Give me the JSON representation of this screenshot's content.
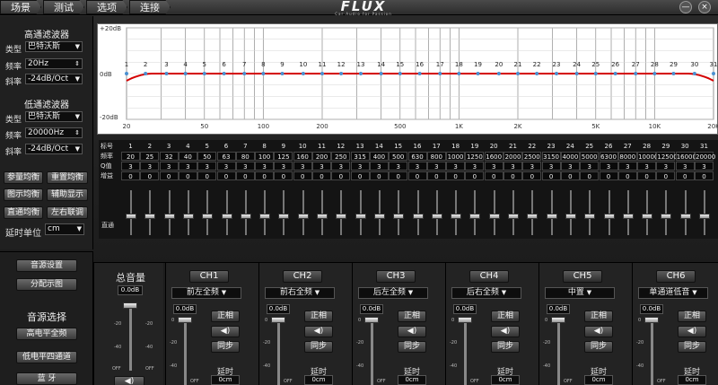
{
  "tabs": [
    "场景",
    "测试",
    "选项",
    "连接"
  ],
  "logo": {
    "brand": "FLUX",
    "tagline": "Car Audio for Passion"
  },
  "window_buttons": [
    "—",
    "×"
  ],
  "highpass": {
    "title": "高通滤波器",
    "type_label": "类型",
    "type_value": "巴特沃斯",
    "freq_label": "频率",
    "freq_value": "20Hz",
    "slope_label": "斜率",
    "slope_value": "-24dB/Oct"
  },
  "lowpass": {
    "title": "低通滤波器",
    "type_label": "类型",
    "type_value": "巴特沃斯",
    "freq_label": "频率",
    "freq_value": "20000Hz",
    "slope_label": "斜率",
    "slope_value": "-24dB/Oct"
  },
  "eq_buttons": [
    "参量均衡",
    "重置均衡",
    "图示均衡",
    "辅助显示",
    "直通均衡",
    "左右联调"
  ],
  "delay_unit": {
    "label": "延时单位",
    "value": "cm"
  },
  "settings_buttons": [
    "音源设置",
    "分配示图"
  ],
  "source": {
    "title": "音源选择",
    "buttons": [
      "高电平全频",
      "低电平四通道",
      "蓝 牙"
    ]
  },
  "graph": {
    "ymax": "+20dB",
    "ymid": "0dB",
    "ymin": "-20dB",
    "xticks": [
      "20",
      "50",
      "100",
      "200",
      "500",
      "1K",
      "2K",
      "5K",
      "10K",
      "20K"
    ]
  },
  "band_table": {
    "row_labels": [
      "标号",
      "频率",
      "Q值",
      "增益"
    ],
    "numbers": [
      "1",
      "2",
      "3",
      "4",
      "5",
      "6",
      "7",
      "8",
      "9",
      "10",
      "11",
      "12",
      "13",
      "14",
      "15",
      "16",
      "17",
      "18",
      "19",
      "20",
      "21",
      "22",
      "23",
      "24",
      "25",
      "26",
      "27",
      "28",
      "29",
      "30",
      "31"
    ],
    "freqs": [
      "20",
      "25",
      "32",
      "40",
      "50",
      "63",
      "80",
      "100",
      "125",
      "160",
      "200",
      "250",
      "315",
      "400",
      "500",
      "630",
      "800",
      "1000",
      "1250",
      "1600",
      "2000",
      "2500",
      "3150",
      "4000",
      "5000",
      "6300",
      "8000",
      "10000",
      "12500",
      "16000",
      "20000"
    ],
    "q": "3",
    "gain": "0",
    "direct_label": "直通"
  },
  "master": {
    "title": "总音量",
    "db": "0.0dB"
  },
  "channels": [
    {
      "name": "CH1",
      "assign": "前左全频",
      "db": "0.0dB",
      "phase": "正相",
      "mute": "◀)",
      "sync": "同步",
      "delay_label": "延时",
      "delay": "0cm"
    },
    {
      "name": "CH2",
      "assign": "前右全频",
      "db": "0.0dB",
      "phase": "正相",
      "mute": "◀)",
      "sync": "同步",
      "delay_label": "延时",
      "delay": "0cm"
    },
    {
      "name": "CH3",
      "assign": "后左全频",
      "db": "0.0dB",
      "phase": "正相",
      "mute": "◀)",
      "sync": "同步",
      "delay_label": "延时",
      "delay": "0cm"
    },
    {
      "name": "CH4",
      "assign": "后右全频",
      "db": "0.0dB",
      "phase": "正相",
      "mute": "◀)",
      "sync": "同步",
      "delay_label": "延时",
      "delay": "0cm"
    },
    {
      "name": "CH5",
      "assign": "中置",
      "db": "0.0dB",
      "phase": "正相",
      "mute": "◀)",
      "sync": "同步",
      "delay_label": "延时",
      "delay": "0cm"
    },
    {
      "name": "CH6",
      "assign": "单通道低音",
      "db": "0.0dB",
      "phase": "正相",
      "mute": "◀)",
      "sync": "同步",
      "delay_label": "延时",
      "delay": "0cm"
    }
  ],
  "slider_ticks": [
    "0",
    "-20",
    "-40",
    "OFF"
  ],
  "colors": {
    "curve": "#d40000",
    "point": "#4a90d0",
    "graph_bg": "#ffffff",
    "grid": "#9a9a9a"
  }
}
